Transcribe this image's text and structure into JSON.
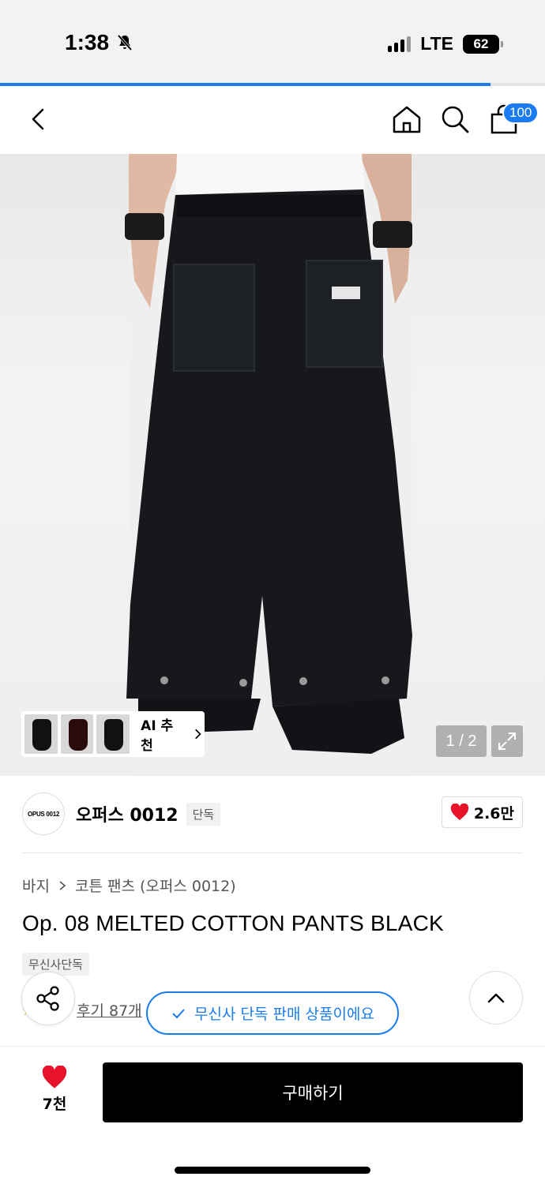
{
  "status_bar": {
    "time": "1:38",
    "network": "LTE",
    "battery": "62"
  },
  "page_progress": 0.9,
  "header": {
    "cart_count": "100"
  },
  "gallery": {
    "ai_label": "AI 추천",
    "counter": "1 / 2"
  },
  "brand": {
    "logo_text": "OPUS 0012",
    "name": "오퍼스 0012",
    "tag": "단독",
    "likes": "2.6만"
  },
  "breadcrumb": {
    "category": "바지",
    "subcategory": "코튼 팬츠 (오퍼스 0012)"
  },
  "product": {
    "title": "Op. 08 MELTED COTTON PANTS BLACK",
    "exclusive_tag": "무신사단독",
    "review_text": "후기 87개"
  },
  "toast": {
    "text": "무신사 단독 판매 상품이에요"
  },
  "bottom_bar": {
    "wish_count": "7천",
    "buy_label": "구매하기"
  },
  "colors": {
    "accent": "#1a7cf0",
    "heart": "#e8132a"
  }
}
